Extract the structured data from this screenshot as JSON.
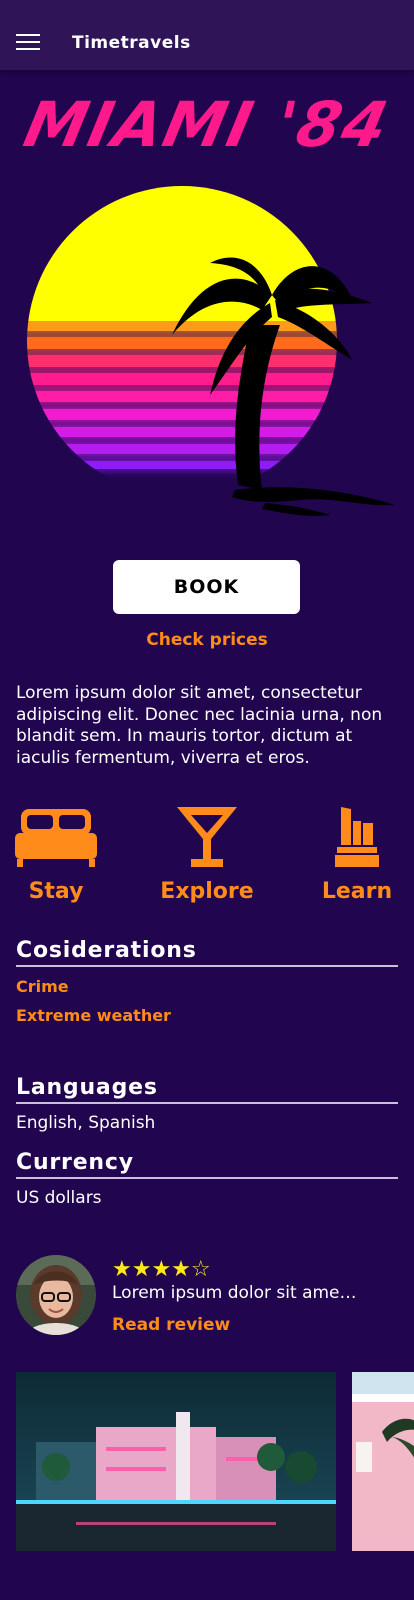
{
  "app_bar": {
    "title": "Timetravels"
  },
  "hero": {
    "title": "MIAMI '84"
  },
  "actions": {
    "book_label": "BOOK",
    "check_prices_label": "Check prices"
  },
  "description": "Lorem ipsum dolor sit amet, consectetur adipiscing elit. Donec nec lacinia urna, non blandit sem. In mauris tortor, dictum at iaculis fermentum, viverra et eros.",
  "features": [
    {
      "label": "Stay",
      "icon": "bed-icon"
    },
    {
      "label": "Explore",
      "icon": "cocktail-icon"
    },
    {
      "label": "Learn",
      "icon": "monument-icon"
    }
  ],
  "considerations": {
    "title": "Cosiderations",
    "items": [
      "Crime",
      "Extreme weather"
    ]
  },
  "languages": {
    "title": "Languages",
    "value": "English, Spanish"
  },
  "currency": {
    "title": "Currency",
    "value": "US dollars"
  },
  "review": {
    "rating": 4,
    "max_rating": 5,
    "stars_display": "★★★★☆",
    "excerpt": "Lorem ipsum dolor sit amet consectetur",
    "read_label": "Read review"
  },
  "colors": {
    "background": "#21054f",
    "app_bar": "#2f1458",
    "accent_orange": "#ff8c1a",
    "neon_pink": "#ff1a8c",
    "sun_yellow": "#ffff00",
    "star_yellow": "#ffe81a"
  }
}
